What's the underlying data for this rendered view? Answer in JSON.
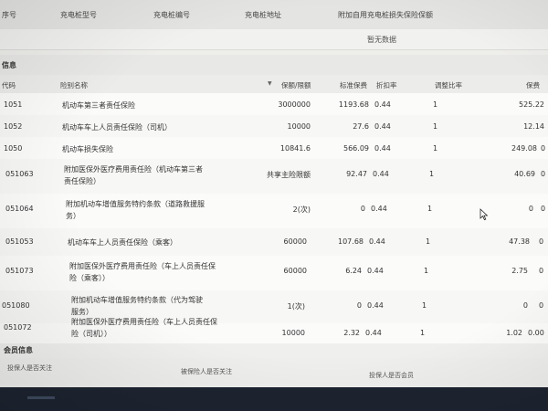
{
  "top_table": {
    "headers": [
      "序号",
      "充电桩型号",
      "充电桩编号",
      "充电桩地址",
      "附加自用充电桩损失保险保额"
    ],
    "empty_text": "暂无数据"
  },
  "coverage_section": {
    "title": "信息",
    "headers": {
      "code": "代码",
      "name": "险别名称",
      "limit": "保额/限额",
      "std_premium": "标准保费",
      "discount": "折扣率",
      "adjust": "调整比率",
      "premium": "保费"
    },
    "rows": [
      {
        "code": "1051",
        "name": "机动车第三者责任保险",
        "limit": "3000000",
        "std_premium": "1193.68",
        "discount": "0.44",
        "adjust": "1",
        "premium": "525.22"
      },
      {
        "code": "1052",
        "name": "机动车车上人员责任保险（司机）",
        "limit": "10000",
        "std_premium": "27.6",
        "discount": "0.44",
        "adjust": "1",
        "premium": "12.14"
      },
      {
        "code": "1050",
        "name": "机动车损失保险",
        "limit": "10841.6",
        "std_premium": "566.09",
        "discount": "0.44",
        "adjust": "1",
        "premium": "249.08"
      },
      {
        "code": "051063",
        "name": "附加医保外医疗费用责任险（机动车第三者责任保险）",
        "limit": "共享主险限额",
        "std_premium": "92.47",
        "discount": "0.44",
        "adjust": "1",
        "premium": "40.69"
      },
      {
        "code": "051064",
        "name": "附加机动车增值服务特约条款（道路救援服务）",
        "limit": "2(次)",
        "std_premium": "0",
        "discount": "0.44",
        "adjust": "1",
        "premium": "0"
      },
      {
        "code": "051053",
        "name": "机动车车上人员责任保险（乘客）",
        "limit": "60000",
        "std_premium": "107.68",
        "discount": "0.44",
        "adjust": "1",
        "premium": "47.38"
      },
      {
        "code": "051073",
        "name": "附加医保外医疗费用责任险（车上人员责任保险（乘客））",
        "limit": "60000",
        "std_premium": "6.24",
        "discount": "0.44",
        "adjust": "1",
        "premium": "2.75"
      },
      {
        "code": "051080",
        "name": "附加机动车增值服务特约条款（代为驾驶服务）",
        "limit": "1(次)",
        "std_premium": "0",
        "discount": "0.44",
        "adjust": "1",
        "premium": "0"
      },
      {
        "code": "051072",
        "name": "附加医保外医疗费用责任险（车上人员责任保险（司机））",
        "limit": "10000",
        "std_premium": "2.32",
        "discount": "0.44",
        "adjust": "1",
        "premium": "1.02"
      }
    ],
    "trailing_values": [
      "0",
      "0",
      "0.00"
    ]
  },
  "member_section": {
    "title": "会员信息",
    "fields": [
      "投保人是否关注",
      "被保险人是否关注",
      "投保人是否会员"
    ]
  }
}
